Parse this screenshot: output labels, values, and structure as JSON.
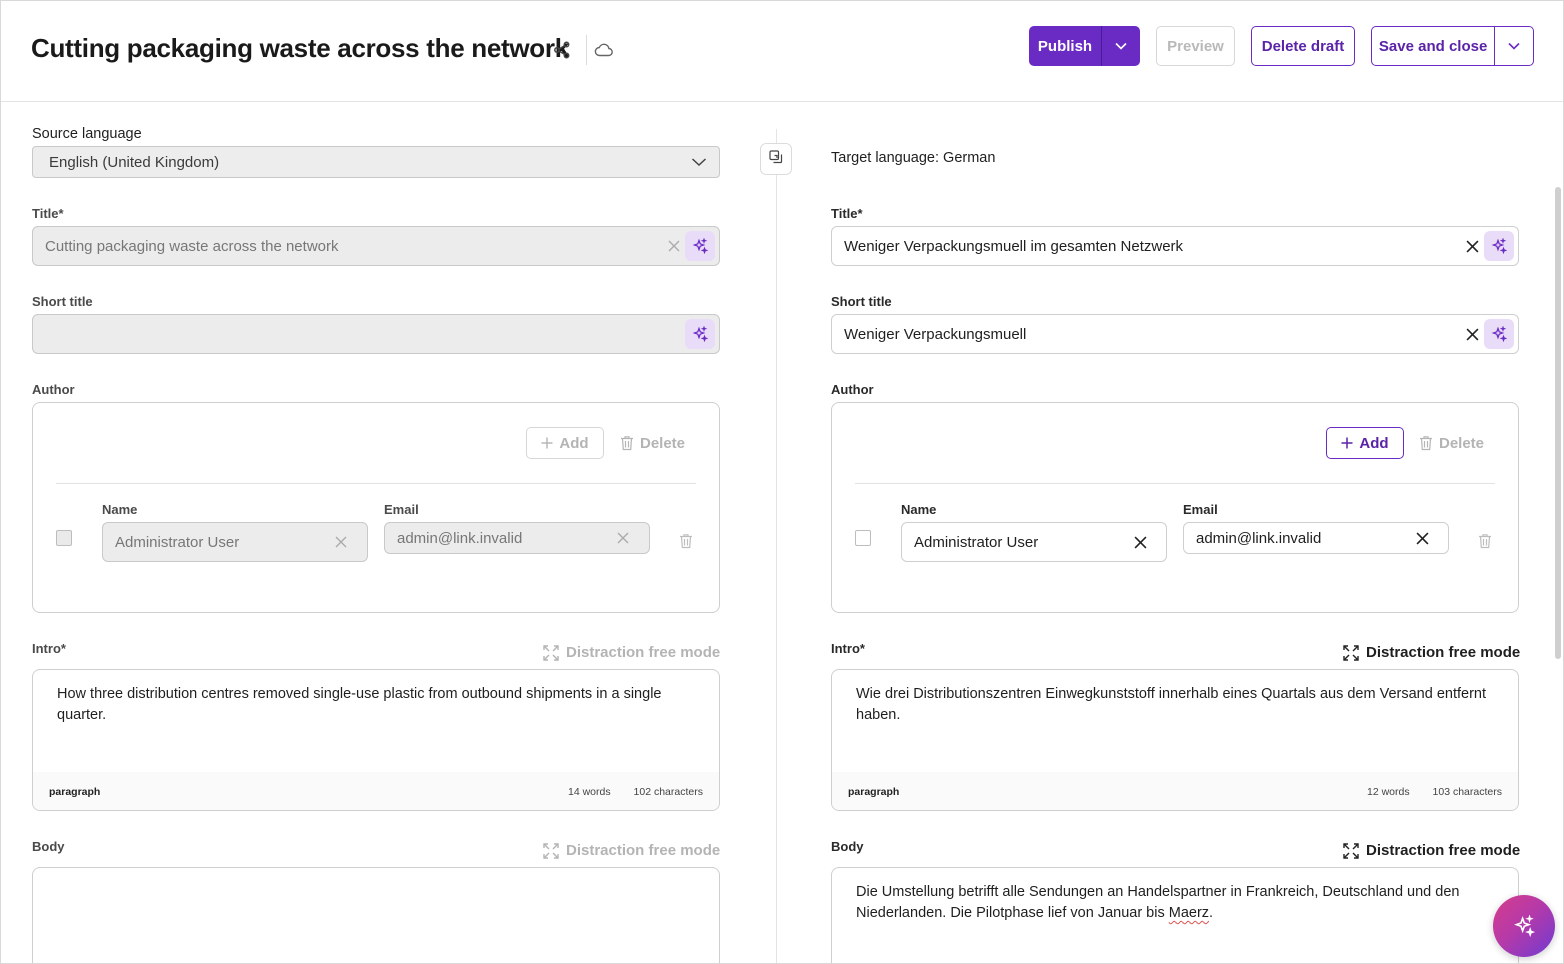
{
  "header": {
    "title": "Cutting packaging waste across the network",
    "publish_label": "Publish",
    "preview_label": "Preview",
    "delete_draft_label": "Delete draft",
    "save_close_label": "Save and close"
  },
  "source": {
    "language_label": "Source language",
    "language_value": "English (United Kingdom)",
    "title_label": "Title*",
    "title_value": "Cutting packaging waste across the network",
    "short_title_label": "Short title",
    "short_title_value": "",
    "author_label": "Author",
    "add_label": "Add",
    "delete_label": "Delete",
    "name_label": "Name",
    "email_label": "Email",
    "name_value": "Administrator User",
    "email_value": "admin@link.invalid",
    "intro_label": "Intro*",
    "dfm_label": "Distraction free mode",
    "intro_text": "How three distribution centres removed single-use plastic from outbound shipments in a single quarter.",
    "paragraph_label": "paragraph",
    "intro_words": "14 words",
    "intro_chars": "102 characters",
    "body_label": "Body",
    "body_text": ""
  },
  "target": {
    "language_label": "Target language: German",
    "title_label": "Title*",
    "title_value": "Weniger Verpackungsmuell im gesamten Netzwerk",
    "short_title_label": "Short title",
    "short_title_value": "Weniger Verpackungsmuell",
    "author_label": "Author",
    "add_label": "Add",
    "delete_label": "Delete",
    "name_label": "Name",
    "email_label": "Email",
    "name_value": "Administrator User",
    "email_value": "admin@link.invalid",
    "intro_label": "Intro*",
    "dfm_label": "Distraction free mode",
    "intro_text": "Wie drei Distributionszentren Einwegkunststoff innerhalb eines Quartals aus dem Versand entfernt haben.",
    "paragraph_label": "paragraph",
    "intro_words": "12 words",
    "intro_chars": "103 characters",
    "body_label": "Body",
    "body_text_pre": "Die Umstellung betrifft alle Sendungen an Handelspartner in Frankreich, Deutschland und den Niederlanden. Die Pilotphase lief von Januar bis ",
    "body_text_misspelled": "Maerz",
    "body_text_post": "."
  },
  "colors": {
    "accent": "#6a2bc4",
    "ai_tint": "#e9dcf9"
  },
  "icons": {
    "share": "share-icon",
    "cloud": "cloud-icon",
    "copy": "copy-language-icon",
    "sparkle": "sparkle-icon",
    "fab": "ai-assistant-icon"
  }
}
